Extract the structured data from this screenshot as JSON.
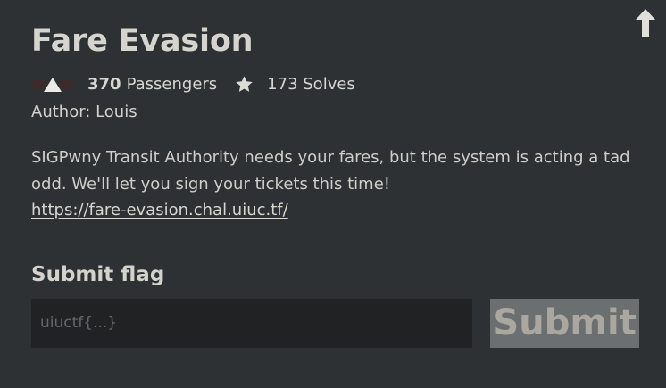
{
  "challenge": {
    "title": "Fare Evasion",
    "points": "370",
    "points_label": "Passengers",
    "solves_label": "173 Solves",
    "author_line": "Author: Louis",
    "description_text": "SIGPwny Transit Authority needs your fares, but the system is acting a tad odd. We'll let you sign your tickets this time!",
    "link_text": "https://fare-evasion.chal.uiuc.tf/",
    "link_href": "https://fare-evasion.chal.uiuc.tf/"
  },
  "submit": {
    "heading": "Submit flag",
    "placeholder": "uiuctf{...}",
    "value": "",
    "button_label": "Submit"
  },
  "icons": {
    "top_right": "arrow-up-icon",
    "points": "triangle-up-icon",
    "solves": "star-icon"
  },
  "colors": {
    "background": "#2d3133",
    "text": "#cfcfca",
    "input_background": "#202224",
    "button_background": "#6c6f6f",
    "button_text": "#aaa7a0"
  }
}
